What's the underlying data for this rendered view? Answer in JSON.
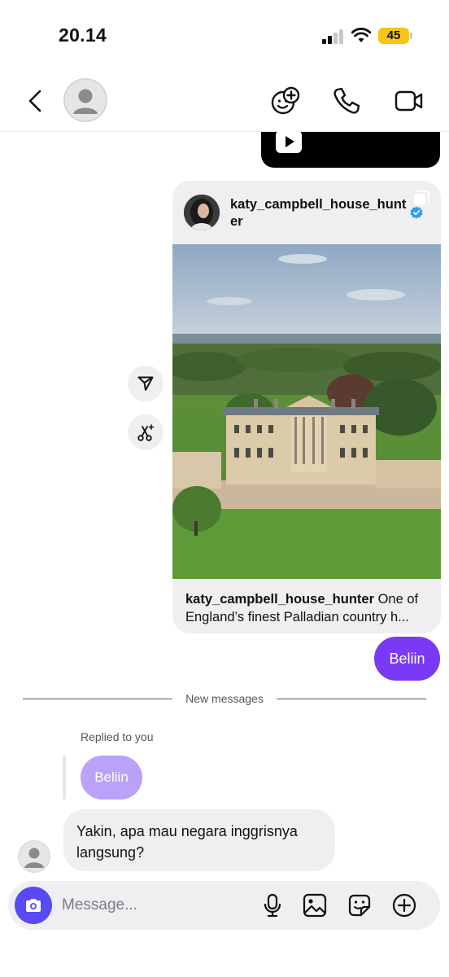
{
  "status_bar": {
    "time": "20.14",
    "battery": "45"
  },
  "header": {
    "icons": [
      "back-icon",
      "avatar-icon",
      "sticker-effects-icon",
      "phone-icon",
      "video-camera-icon"
    ]
  },
  "shared_post": {
    "username": "katy_campbell_house_hunter",
    "caption_user": "katy_campbell_house_hunter",
    "caption_text": " One of",
    "caption_line2": "England’s finest Palladian country h..."
  },
  "side_actions": [
    "share-icon",
    "remix-icon"
  ],
  "messages": {
    "outgoing_text": "Beliin",
    "divider_label": "New messages",
    "replied_label": "Replied to you",
    "reply_quote": "Beliin",
    "incoming_text": "Yakin, apa mau negara inggrisnya langsung?"
  },
  "composer": {
    "placeholder": "Message...",
    "icons": [
      "camera-icon",
      "microphone-icon",
      "gallery-icon",
      "sticker-icon",
      "add-icon"
    ]
  },
  "colors": {
    "accent": "#7a3af5",
    "quote": "#b9a2f7",
    "camera": "#5a4af4",
    "bubble_gray": "#efeff2",
    "battery": "#f5c518"
  }
}
